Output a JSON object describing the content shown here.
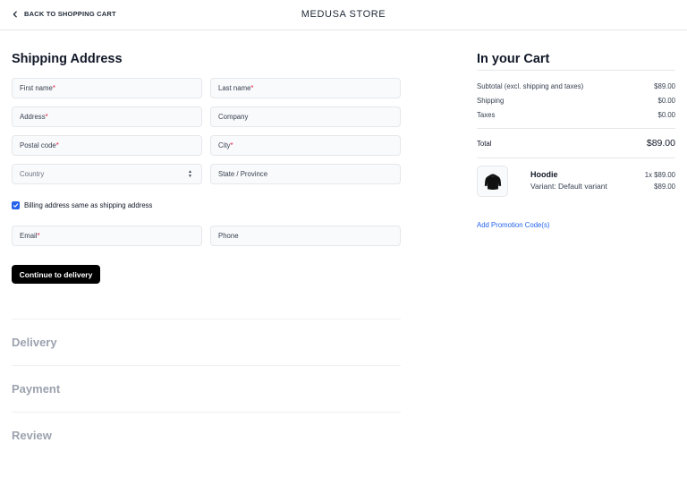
{
  "header": {
    "back_label": "BACK TO SHOPPING CART",
    "store_name": "MEDUSA STORE"
  },
  "shipping": {
    "title": "Shipping Address",
    "fields": {
      "first_name": "First name",
      "last_name": "Last name",
      "address": "Address",
      "company": "Company",
      "postal_code": "Postal code",
      "city": "City",
      "country": "Country",
      "state": "State / Province",
      "email": "Email",
      "phone": "Phone"
    },
    "required_mark": "*",
    "billing_same_label": "Billing address same as shipping address",
    "billing_same_checked": true,
    "continue_label": "Continue to delivery"
  },
  "steps": {
    "delivery": "Delivery",
    "payment": "Payment",
    "review": "Review"
  },
  "cart": {
    "title": "In your Cart",
    "subtotal_label": "Subtotal (excl. shipping and taxes)",
    "subtotal_value": "$89.00",
    "shipping_label": "Shipping",
    "shipping_value": "$0.00",
    "taxes_label": "Taxes",
    "taxes_value": "$0.00",
    "total_label": "Total",
    "total_value": "$89.00",
    "item": {
      "name": "Hoodie",
      "variant": "Variant: Default variant",
      "qty_price": "1x $89.00",
      "line_total": "$89.00"
    },
    "promo_label": "Add Promotion Code(s)"
  },
  "icons": {
    "back": "chevron-left-icon",
    "select": "select-updown-icon",
    "checkbox": "check-icon",
    "thumbnail": "hoodie-image"
  },
  "colors": {
    "accent": "#2563eb",
    "required": "#e11d48",
    "button": "#000000",
    "muted_heading": "#9ca3af"
  }
}
